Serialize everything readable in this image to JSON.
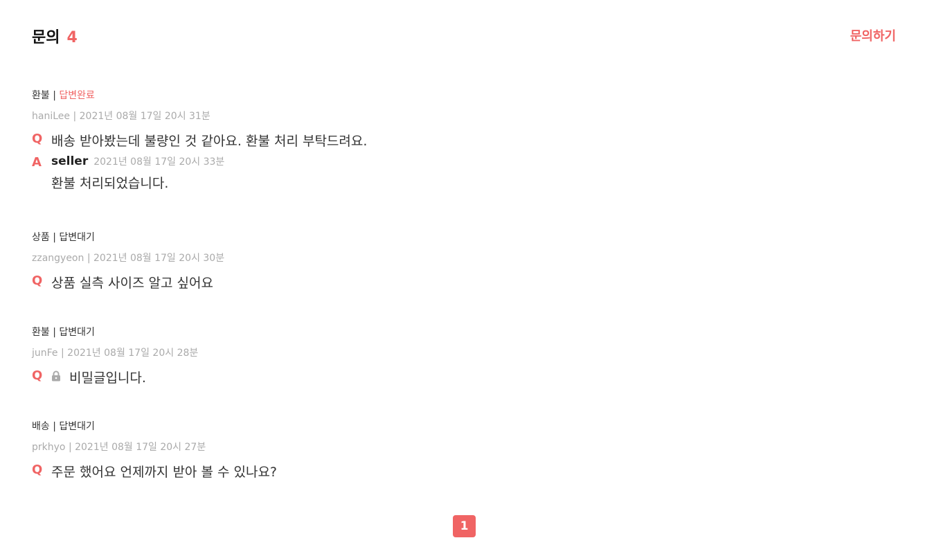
{
  "header": {
    "title": "문의",
    "count": "4",
    "ask_button": "문의하기"
  },
  "inquiries": [
    {
      "category": "환불",
      "separator": "|",
      "status": "답변완료",
      "author": "haniLee",
      "date": "2021년 08월 17일 20시 31분",
      "q_mark": "Q",
      "question": "배송 받아봤는데 불량인 것 같아요. 환불 처리 부탁드려요.",
      "answer": {
        "a_mark": "A",
        "author": "seller",
        "date": "2021년 08월 17일 20시 33분",
        "text": "환불 처리되었습니다."
      }
    },
    {
      "category": "상품",
      "separator": "|",
      "status": "답변대기",
      "author": "zzangyeon",
      "date": "2021년 08월 17일 20시 30분",
      "q_mark": "Q",
      "question": "상품 실측 사이즈 알고 싶어요"
    },
    {
      "category": "환불",
      "separator": "|",
      "status": "답변대기",
      "author": "junFe",
      "date": "2021년 08월 17일 20시 28분",
      "q_mark": "Q",
      "question": "비밀글입니다.",
      "icon": "lock-icon"
    },
    {
      "category": "배송",
      "separator": "|",
      "status": "답변대기",
      "author": "prkhyo",
      "date": "2021년 08월 17일 20시 27분",
      "q_mark": "Q",
      "question": "주문 했어요 언제까지 받아 볼 수 있나요?"
    }
  ],
  "pagination": {
    "current": "1"
  },
  "colors": {
    "accent": "#f06464",
    "muted": "#aaaaaa",
    "text": "#333333"
  }
}
